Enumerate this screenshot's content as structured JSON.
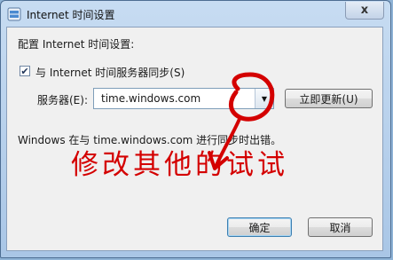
{
  "window": {
    "title": "Internet 时间设置",
    "close_glyph": "x"
  },
  "dialog": {
    "section_label": "配置 Internet 时间设置:",
    "sync_checkbox": {
      "checked": true,
      "label": "与 Internet 时间服务器同步(S)"
    },
    "server": {
      "label": "服务器(E):",
      "value": "time.windows.com"
    },
    "update_button": "立即更新(U)",
    "status_text": "Windows 在与 time.windows.com 进行同步时出错。",
    "ok_button": "确定",
    "cancel_button": "取消"
  },
  "annotation": {
    "handwritten_text": "修改其他的试试",
    "color": "#d40000"
  }
}
